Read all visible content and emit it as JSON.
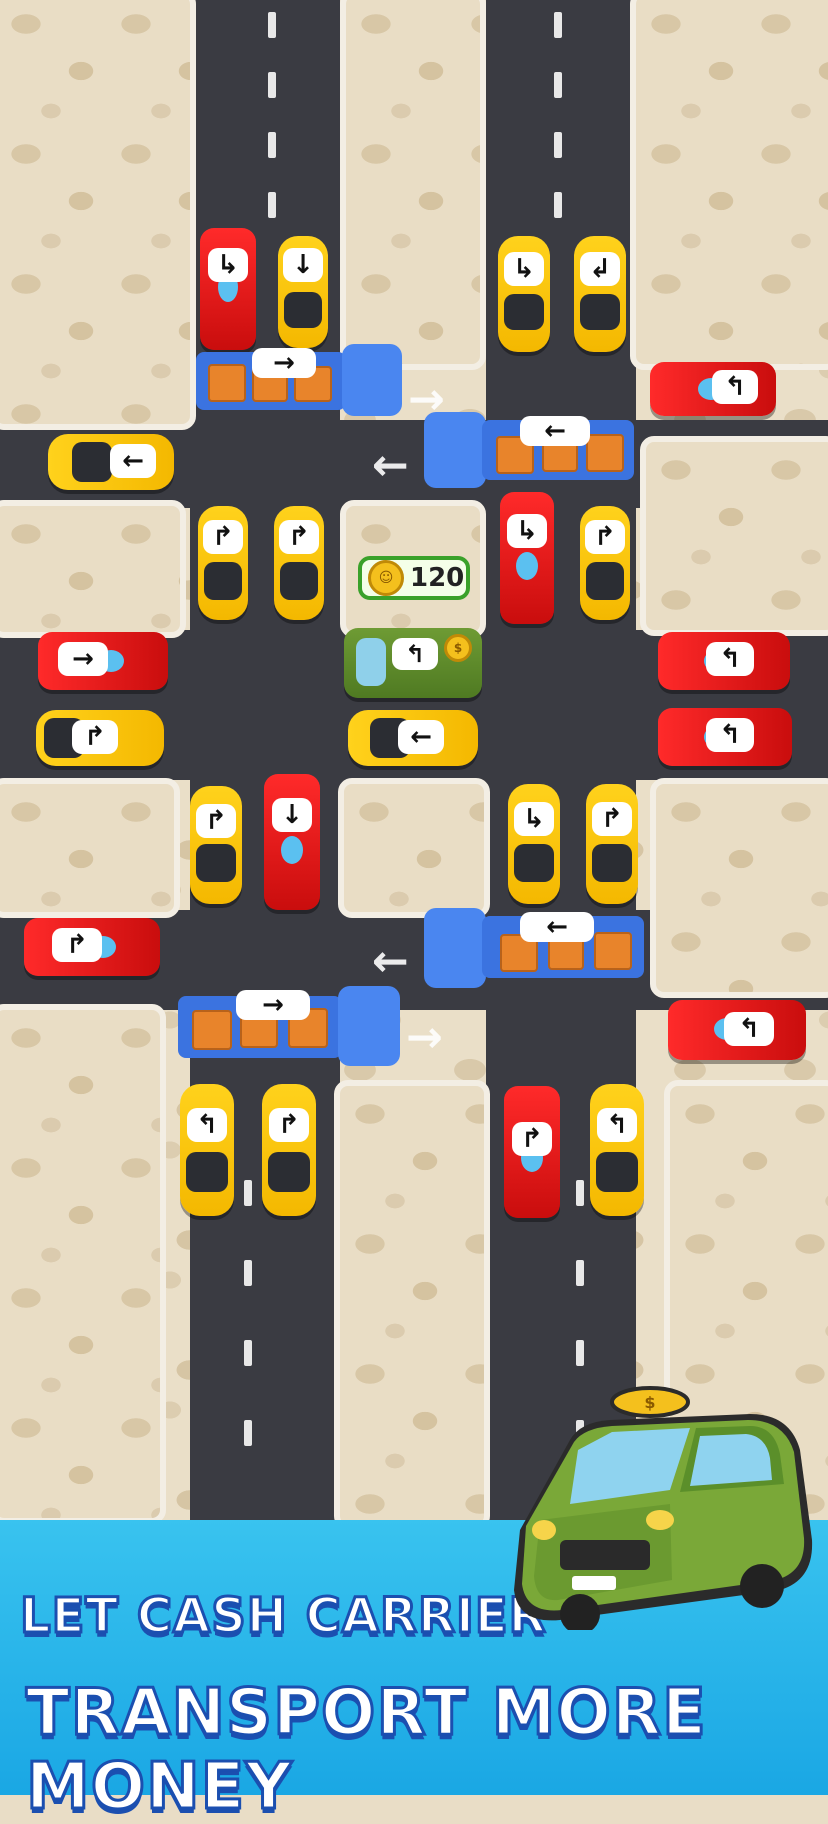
{
  "game": {
    "coin_reward": "120",
    "banner_line1": "LET CASH CARRIER",
    "banner_line2": "TRANSPORT MORE MONEY"
  },
  "icons": {
    "coin": "coin-icon",
    "dollar": "dollar-icon",
    "arrow_left": "←",
    "arrow_right": "→",
    "arrow_up": "↑",
    "arrow_down": "↓",
    "turn_left": "↰",
    "turn_right": "↱",
    "turn_down_right": "↳",
    "turn_down_left": "↲"
  },
  "colors": {
    "road": "#3a3b42",
    "taxi": "#ffd21c",
    "f1": "#e01414",
    "truck": "#3b73e0",
    "cash_carrier": "#5c8a2a",
    "banner": "#2bb7ea",
    "banner_text_outline": "#1b4fb0"
  }
}
